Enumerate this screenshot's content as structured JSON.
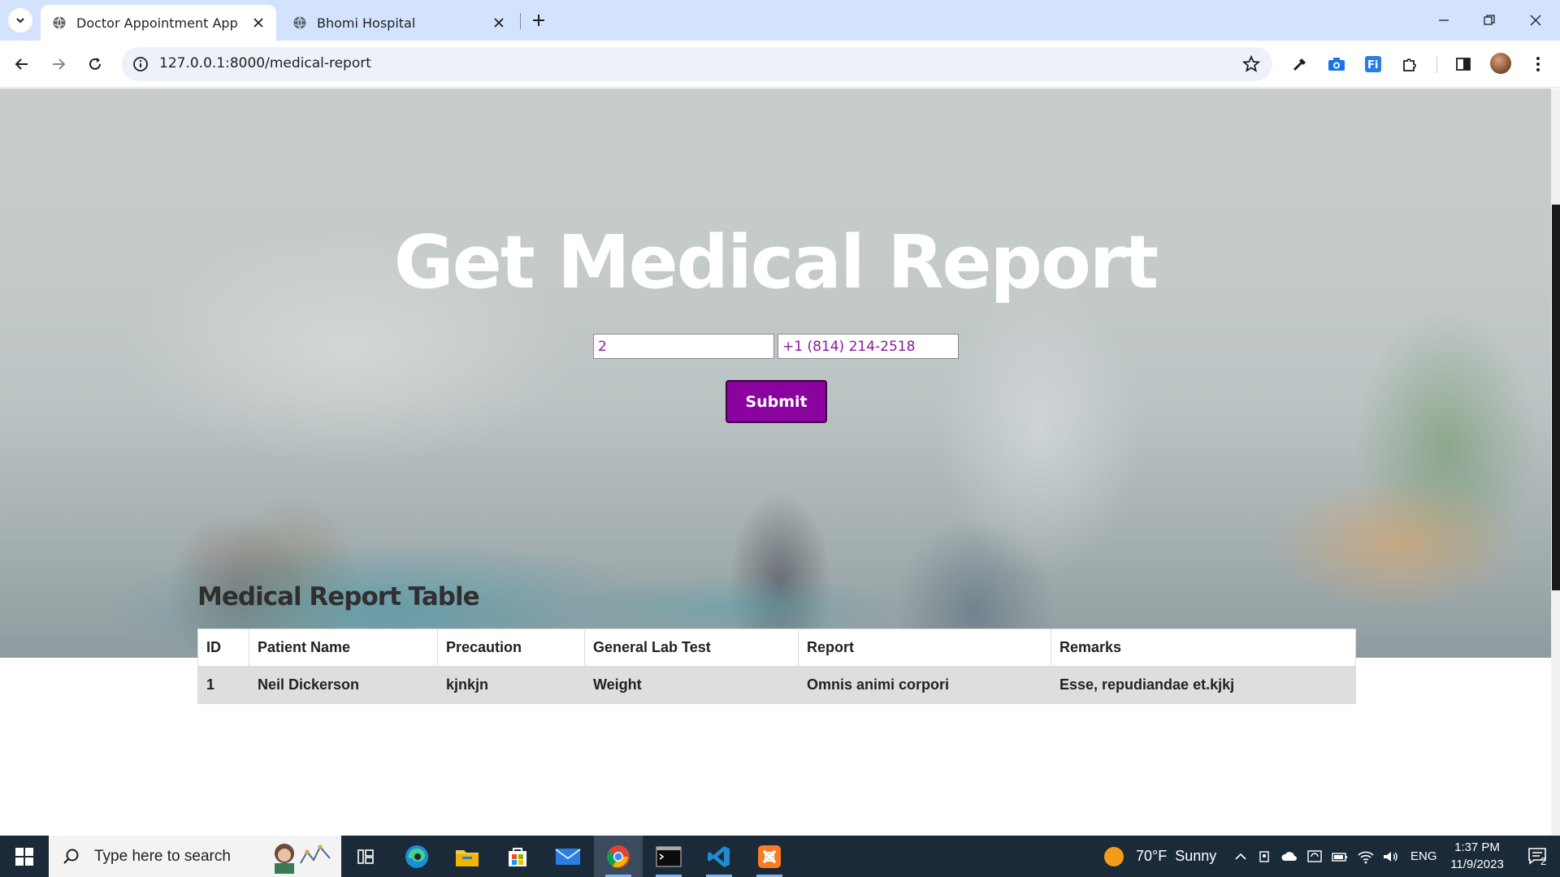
{
  "browser": {
    "tabs": [
      {
        "label": "Doctor Appointment App",
        "active": true
      },
      {
        "label": "Bhomi Hospital",
        "active": false
      }
    ],
    "url": "127.0.0.1:8000/medical-report"
  },
  "hero": {
    "title": "Get Medical Report",
    "id_value": "2",
    "phone_value": "+1 (814) 214-2518",
    "submit_label": "Submit"
  },
  "report": {
    "title": "Medical Report Table",
    "columns": [
      "ID",
      "Patient Name",
      "Precaution",
      "General Lab Test",
      "Report",
      "Remarks"
    ],
    "rows": [
      [
        "1",
        "Neil Dickerson",
        "kjnkjn",
        "Weight",
        "Omnis animi corpori",
        "Esse, repudiandae et.kjkj"
      ]
    ]
  },
  "taskbar": {
    "search_placeholder": "Type here to search",
    "weather": {
      "temp": "70°F",
      "condition": "Sunny"
    },
    "language": "ENG",
    "time": "1:37 PM",
    "date": "11/9/2023",
    "notifications": "2"
  },
  "colors": {
    "accent": "#8a039f",
    "field_text": "#8a1a9e",
    "tabstrip": "#d3e3fd",
    "taskbar": "#1b2a38"
  }
}
